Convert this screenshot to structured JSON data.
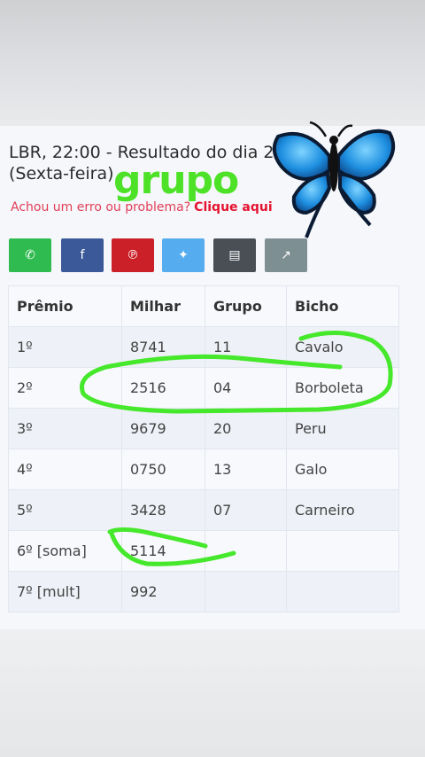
{
  "header": {
    "title_line1": "LBR, 22:00 - Resultado do dia 21/",
    "title_line2": "(Sexta-feira)",
    "overlay_word": "grupo",
    "report_text": "Achou um erro ou problema?",
    "report_link": "Clique aqui"
  },
  "share_buttons": [
    {
      "icon": "whatsapp-icon",
      "color": "#2fbb4f"
    },
    {
      "icon": "facebook-icon",
      "color": "#3b5998"
    },
    {
      "icon": "pinterest-icon",
      "color": "#cb2027"
    },
    {
      "icon": "twitter-icon",
      "color": "#55acee"
    },
    {
      "icon": "print-icon",
      "color": "#4a4f56"
    },
    {
      "icon": "share-icon",
      "color": "#7e8f94"
    }
  ],
  "table": {
    "headers": [
      "Prêmio",
      "Milhar",
      "Grupo",
      "Bicho"
    ],
    "rows": [
      [
        "1º",
        "8741",
        "11",
        "Cavalo"
      ],
      [
        "2º",
        "2516",
        "04",
        "Borboleta"
      ],
      [
        "3º",
        "9679",
        "20",
        "Peru"
      ],
      [
        "4º",
        "0750",
        "13",
        "Galo"
      ],
      [
        "5º",
        "3428",
        "07",
        "Carneiro"
      ],
      [
        "6º [soma]",
        "5114",
        "",
        ""
      ],
      [
        "7º [mult]",
        "992",
        "",
        ""
      ]
    ]
  },
  "decorations": {
    "butterfly_icon": "butterfly-emoji",
    "highlight_color": "#45e82b",
    "butterfly_color": "#1e8fe0"
  }
}
